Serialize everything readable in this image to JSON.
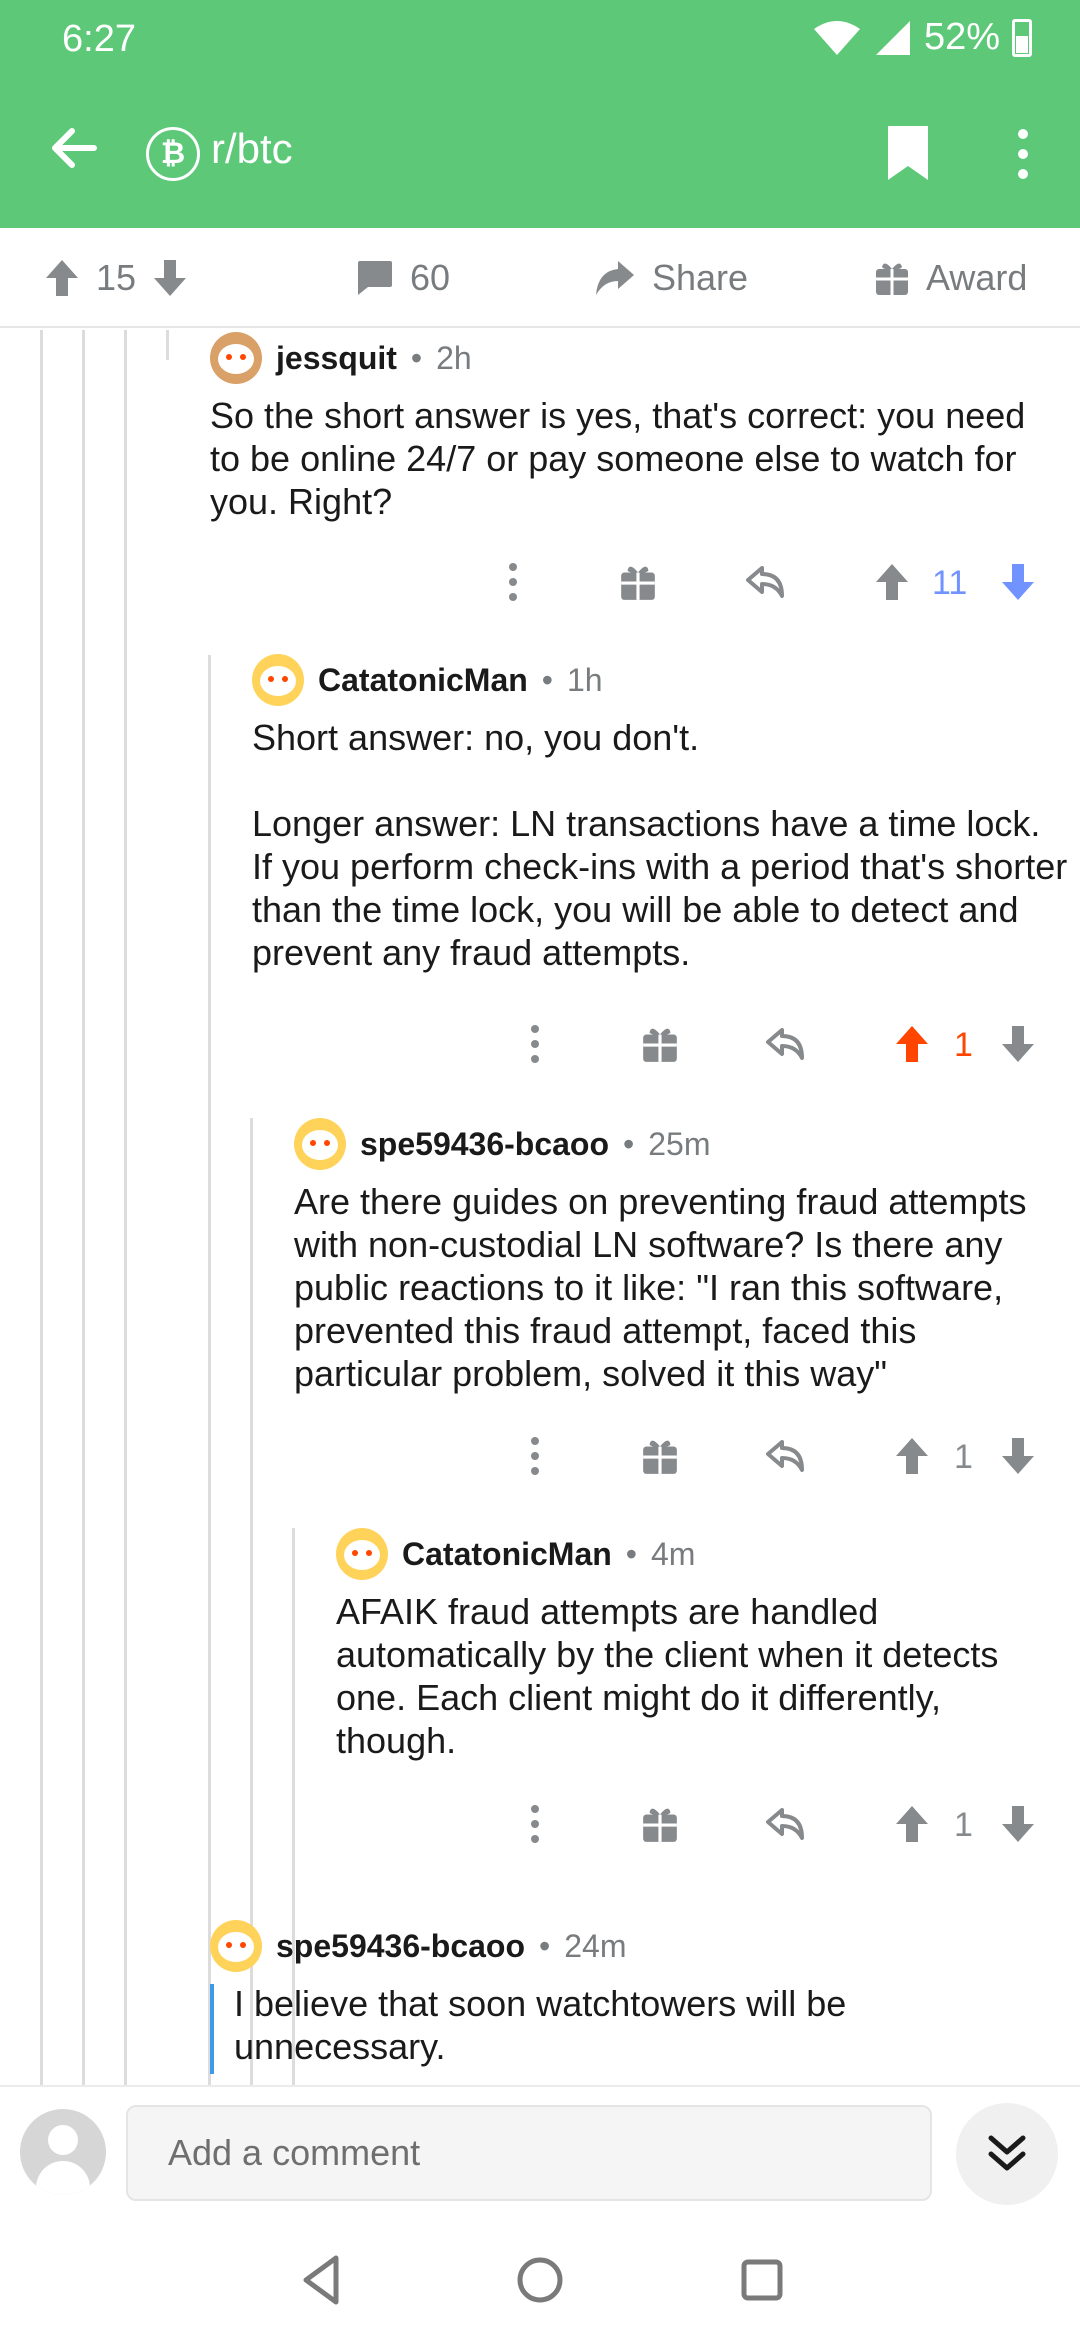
{
  "status_bar": {
    "time": "6:27",
    "battery": "52%"
  },
  "header": {
    "subreddit": "r/btc",
    "subreddit_icon": "bitcoin-icon",
    "colors": {
      "background": "#5cc878",
      "foreground": "#ffffff"
    }
  },
  "action_bar": {
    "upvotes": "15",
    "comments": "60",
    "share_label": "Share",
    "award_label": "Award"
  },
  "comments": [
    {
      "username": "jessquit",
      "age": "2h",
      "body": [
        "So the short answer is yes, that's correct: you need to be online 24/7 or pay someone else to watch for you. Right?"
      ],
      "score": "11",
      "vote_state": "downvoted"
    },
    {
      "username": "CatatonicMan",
      "age": "1h",
      "body": [
        "Short answer: no, you don't.",
        "Longer answer: LN transactions have a time lock. If you perform check-ins with a period that's shorter than the time lock, you will be able to detect and prevent any fraud attempts."
      ],
      "score": "1",
      "vote_state": "upvoted"
    },
    {
      "username": "spe59436-bcaoo",
      "age": "25m",
      "body": [
        "Are there guides on preventing fraud attempts with non-custodial LN software? Is there any public reactions to it like: \"I ran this software, prevented this fraud attempt, faced this particular problem, solved it this way\""
      ],
      "score": "1",
      "vote_state": "none"
    },
    {
      "username": "CatatonicMan",
      "age": "4m",
      "body": [
        "AFAIK fraud attempts are handled automatically by the client when it detects one. Each client might do it differently, though."
      ],
      "score": "1",
      "vote_state": "none"
    },
    {
      "username": "spe59436-bcaoo",
      "age": "24m",
      "body": [
        "I believe that soon watchtowers will be unnecessary."
      ]
    }
  ],
  "vote_colors": {
    "upvoted": "#ff4500",
    "downvoted": "#7193ff",
    "neutral": "#878a8c"
  },
  "composer": {
    "placeholder": "Add a comment"
  }
}
